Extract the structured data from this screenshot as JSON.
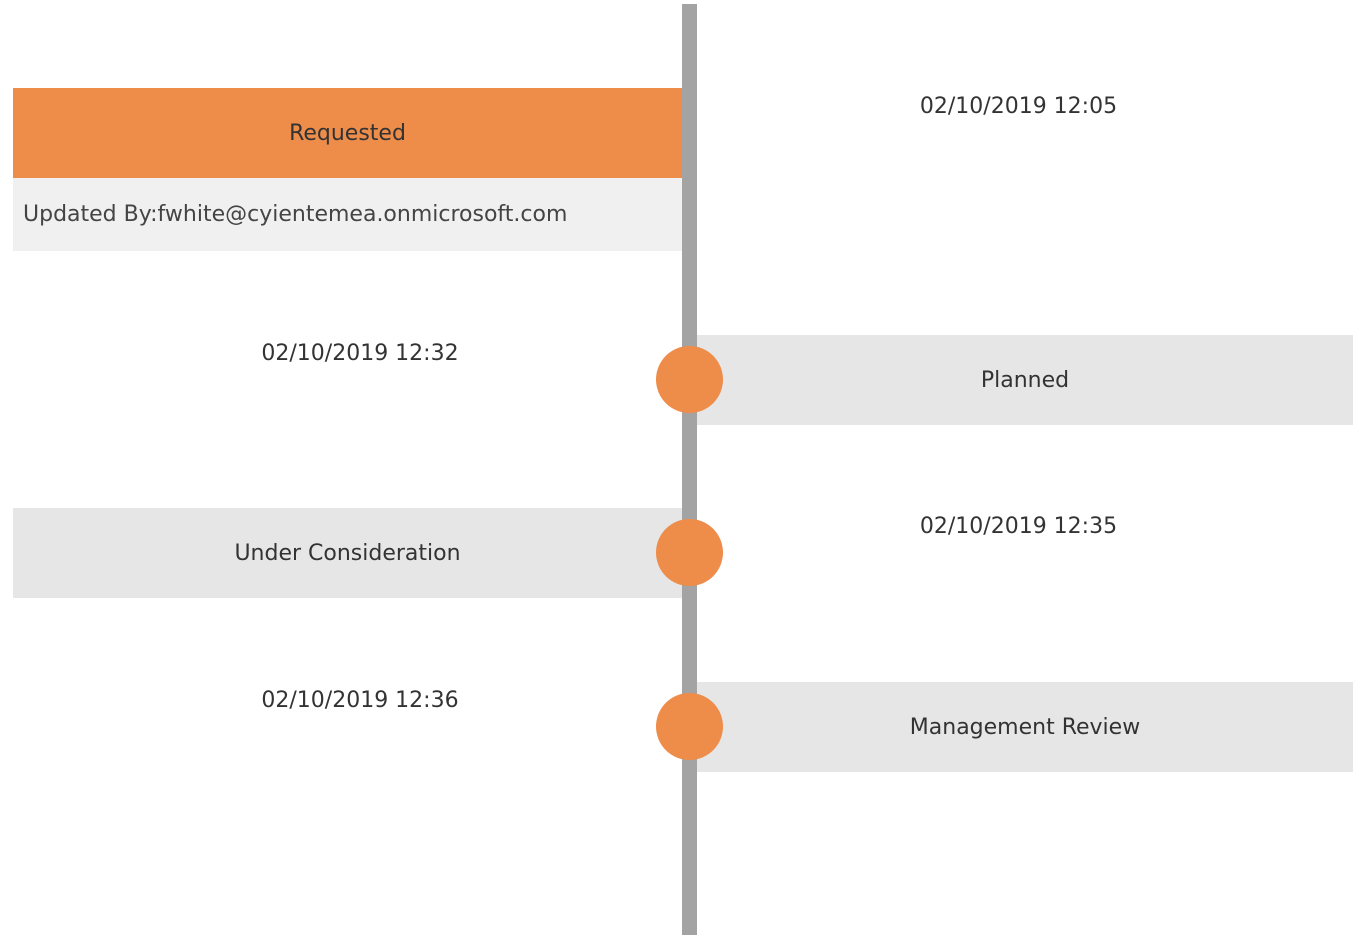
{
  "timeline": {
    "accent_color": "#ee8c4a",
    "line_color": "#a3a3a3",
    "entries": [
      {
        "status": "Requested",
        "timestamp": "02/10/2019 12:05",
        "detail": "Updated By:fwhite@cyientemea.onmicrosoft.com",
        "expanded": true
      },
      {
        "status": "Planned",
        "timestamp": "02/10/2019 12:32",
        "expanded": false
      },
      {
        "status": "Under Consideration",
        "timestamp": "02/10/2019 12:35",
        "expanded": false
      },
      {
        "status": "Management Review",
        "timestamp": "02/10/2019 12:36",
        "expanded": false
      }
    ]
  }
}
